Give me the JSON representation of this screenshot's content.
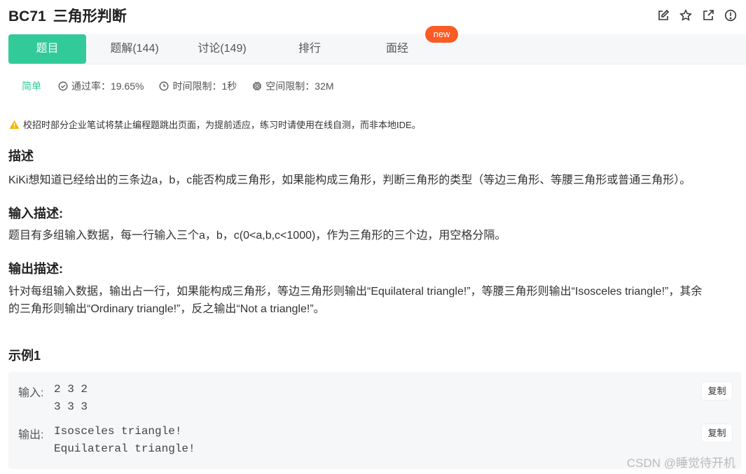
{
  "header": {
    "problem_id": "BC71",
    "problem_title": "三角形判断",
    "icons": [
      "edit-icon",
      "star-icon",
      "external-link-icon",
      "info-icon"
    ]
  },
  "tabs": [
    {
      "label": "题目",
      "active": true
    },
    {
      "label": "题解(144)",
      "active": false
    },
    {
      "label": "讨论(149)",
      "active": false
    },
    {
      "label": "排行",
      "active": false
    },
    {
      "label": "面经",
      "active": false
    }
  ],
  "new_badge": "new",
  "meta": {
    "difficulty": "简单",
    "pass_rate": "通过率：19.65%",
    "time_limit": "时间限制：1秒",
    "space_limit": "空间限制：32M"
  },
  "warning": "校招时部分企业笔试将禁止编程题跳出页面，为提前适应，练习时请使用在线自测，而非本地IDE。",
  "description": {
    "heading": "描述",
    "text": "KiKi想知道已经给出的三条边a，b，c能否构成三角形，如果能构成三角形，判断三角形的类型（等边三角形、等腰三角形或普通三角形）。"
  },
  "input_desc": {
    "heading": "输入描述:",
    "text": "题目有多组输入数据，每一行输入三个a，b，c(0<a,b,c<1000)，作为三角形的三个边，用空格分隔。"
  },
  "output_desc": {
    "heading": "输出描述:",
    "line1": "针对每组输入数据，输出占一行，如果能构成三角形，等边三角形则输出“Equilateral triangle!”，等腰三角形则输出“Isosceles triangle!”，其余",
    "line2": "的三角形则输出“Ordinary triangle!”，反之输出“Not a triangle!”。"
  },
  "example": {
    "heading": "示例1",
    "input_label": "输入:",
    "input_lines": [
      "2 3 2",
      "3 3 3"
    ],
    "output_label": "输出:",
    "output_lines": [
      "Isosceles triangle!",
      "Equilateral triangle!"
    ],
    "copy_label": "复制"
  },
  "watermark": "CSDN @睡觉待开机",
  "colors": {
    "accent": "#32ca99",
    "badge": "#fb5b24",
    "warning": "#f5b400"
  }
}
